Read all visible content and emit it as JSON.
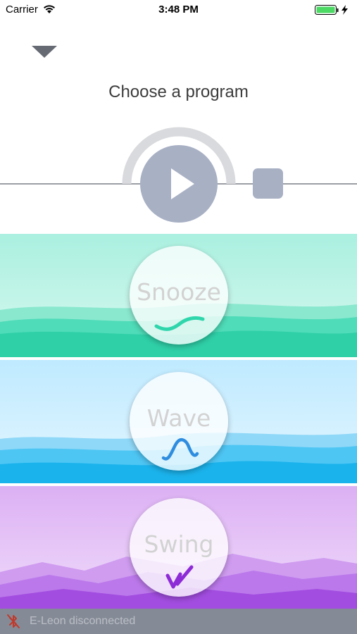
{
  "status_bar": {
    "carrier": "Carrier",
    "time": "3:48 PM",
    "battery_color": "#4cd964"
  },
  "header": {
    "title": "Choose a program",
    "collapse_icon": "chevron-down-icon"
  },
  "player": {
    "play_icon": "play-icon",
    "stop_icon": "stop-icon",
    "accent": "#a8b0c4"
  },
  "programs": [
    {
      "label": "Snooze",
      "icon": "snooze-wave-icon",
      "color": "#2fd6ac"
    },
    {
      "label": "Wave",
      "icon": "sine-wave-icon",
      "color": "#1fb8ee"
    },
    {
      "label": "Swing",
      "icon": "swing-check-icon",
      "color": "#a24de0"
    }
  ],
  "connection": {
    "status_text": "E-Leon disconnected",
    "icon": "bluetooth-disabled-icon",
    "icon_color": "#c0392b"
  }
}
